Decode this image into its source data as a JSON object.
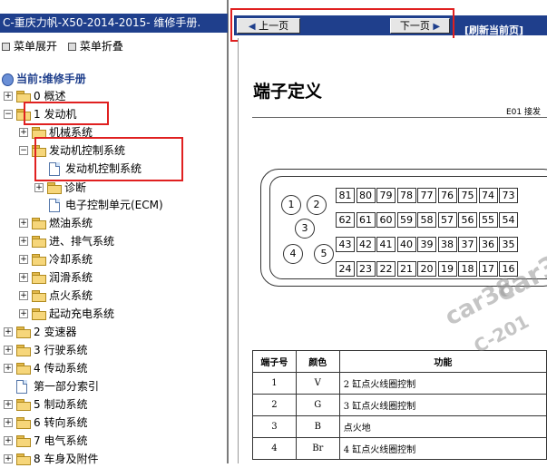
{
  "left_panel": {
    "title": "C-重庆力帆-X50-2014-2015- 维修手册.",
    "expand_all": "菜单展开",
    "collapse_all": "菜单折叠",
    "current_label": "当前:维修手册"
  },
  "tree": [
    {
      "label": "0 概述"
    },
    {
      "label": "1 发动机"
    },
    {
      "label": "机械系统"
    },
    {
      "label": "发动机控制系统"
    },
    {
      "label": "发动机控制系统"
    },
    {
      "label": "诊断"
    },
    {
      "label": "电子控制单元(ECM)"
    },
    {
      "label": "燃油系统"
    },
    {
      "label": "进、排气系统"
    },
    {
      "label": "冷却系统"
    },
    {
      "label": "润滑系统"
    },
    {
      "label": "点火系统"
    },
    {
      "label": "起动充电系统"
    },
    {
      "label": "2 变速器"
    },
    {
      "label": "3 行驶系统"
    },
    {
      "label": "4 传动系统"
    },
    {
      "label": "第一部分索引"
    },
    {
      "label": "5 制动系统"
    },
    {
      "label": "6 转向系统"
    },
    {
      "label": "7 电气系统"
    },
    {
      "label": "8 车身及附件"
    }
  ],
  "toolbar": {
    "prev_label": "上一页",
    "next_label": "下一页",
    "refresh_label": "[刷新当前页]"
  },
  "page": {
    "title": "端子定义",
    "connector_label": "E01 接发",
    "round_pins": [
      "1",
      "2",
      "3",
      "4",
      "5"
    ],
    "pin_rows": [
      [
        "81",
        "80",
        "79",
        "78",
        "77",
        "76",
        "75",
        "74",
        "73"
      ],
      [
        "62",
        "61",
        "60",
        "59",
        "58",
        "57",
        "56",
        "55",
        "54"
      ],
      [
        "43",
        "42",
        "41",
        "40",
        "39",
        "38",
        "37",
        "36",
        "35"
      ],
      [
        "24",
        "23",
        "22",
        "21",
        "20",
        "19",
        "18",
        "17",
        "16"
      ]
    ],
    "table_headers": [
      "端子号",
      "颜色",
      "功能"
    ],
    "table_rows": [
      [
        "1",
        "V",
        "2 缸点火线圈控制"
      ],
      [
        "2",
        "G",
        "3 缸点火线圈控制"
      ],
      [
        "3",
        "B",
        "点火地"
      ],
      [
        "4",
        "Br",
        "4 缸点火线圈控制"
      ]
    ],
    "watermark_1": "car38",
    "watermark_2": "car3",
    "watermark_3": "C-201"
  },
  "colors": {
    "title_bar": "#1f3f8c",
    "highlight_box": "#e02020"
  }
}
